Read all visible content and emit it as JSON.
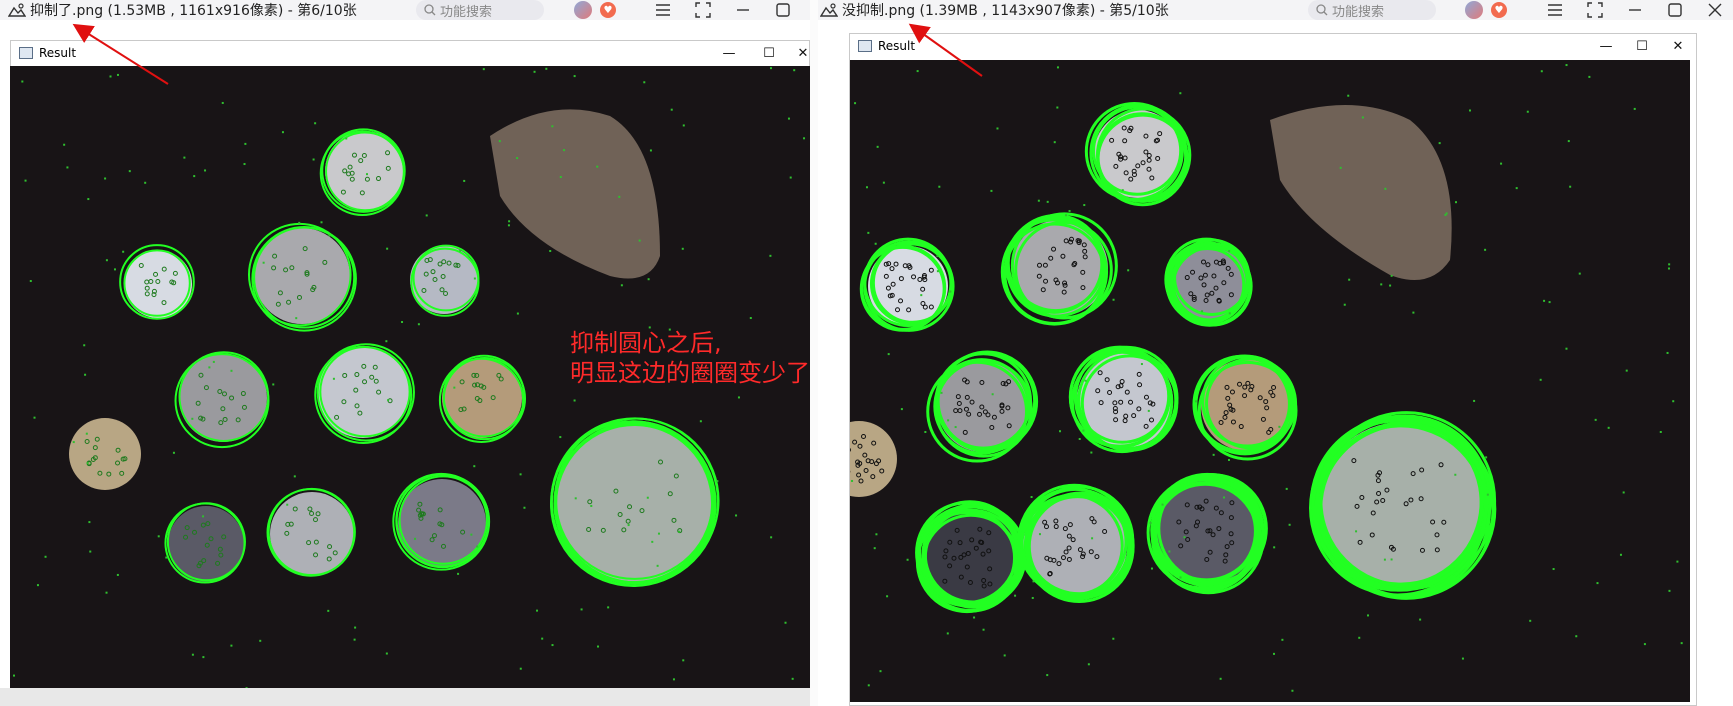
{
  "left_viewer": {
    "title": "抑制了.png (1.53MB , 1161x916像素) - 第6/10张",
    "search_placeholder": "功能搜索"
  },
  "right_viewer": {
    "title": "没抑制.png (1.39MB , 1143x907像素) - 第5/10张",
    "search_placeholder": "功能搜索"
  },
  "left_window": {
    "title": "Result"
  },
  "right_window": {
    "title": "Result"
  },
  "annotation": {
    "line1": "抑制圆心之后,",
    "line2": "明显这边的圈圈变少了",
    "color": "#ff2a2a"
  },
  "colors": {
    "circle": "#22ff22",
    "background": "#181416",
    "arrow": "#e01010"
  },
  "icons": [
    "image-icon",
    "search-icon",
    "menu-icon",
    "fullscreen-icon",
    "minimize-icon",
    "maximize-icon",
    "close-icon"
  ]
}
